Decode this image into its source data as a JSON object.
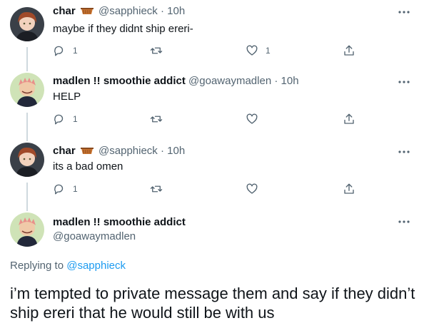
{
  "tweets": [
    {
      "name": "char",
      "emoji": "basket-emoji",
      "handle": "@sapphieck",
      "dot": "·",
      "time": "10h",
      "text": "maybe if they didnt ship ereri-",
      "reply_count": "1",
      "retweet_count": "",
      "like_count": "1"
    },
    {
      "name": "madlen !! smoothie addict",
      "handle": "@goawaymadlen",
      "dot": "·",
      "time": "10h",
      "text": "HELP",
      "reply_count": "1",
      "retweet_count": "",
      "like_count": ""
    },
    {
      "name": "char",
      "emoji": "basket-emoji",
      "handle": "@sapphieck",
      "dot": "·",
      "time": "10h",
      "text": "its a bad omen",
      "reply_count": "1",
      "retweet_count": "",
      "like_count": ""
    }
  ],
  "main_tweet": {
    "name": "madlen !! smoothie addict",
    "handle": "@goawaymadlen",
    "replying_prefix": "Replying to",
    "replying_to": "@sapphieck",
    "text": "i’m tempted to private message them and say if they didn’t ship ereri that he would still be with us"
  },
  "colors": {
    "text": "#0f1419",
    "secondary": "#536471",
    "link": "#1d9bf0",
    "thread_line": "#cfd9de"
  },
  "icons": [
    "reply-icon",
    "retweet-icon",
    "like-icon",
    "share-icon",
    "more-icon",
    "basket-emoji"
  ]
}
